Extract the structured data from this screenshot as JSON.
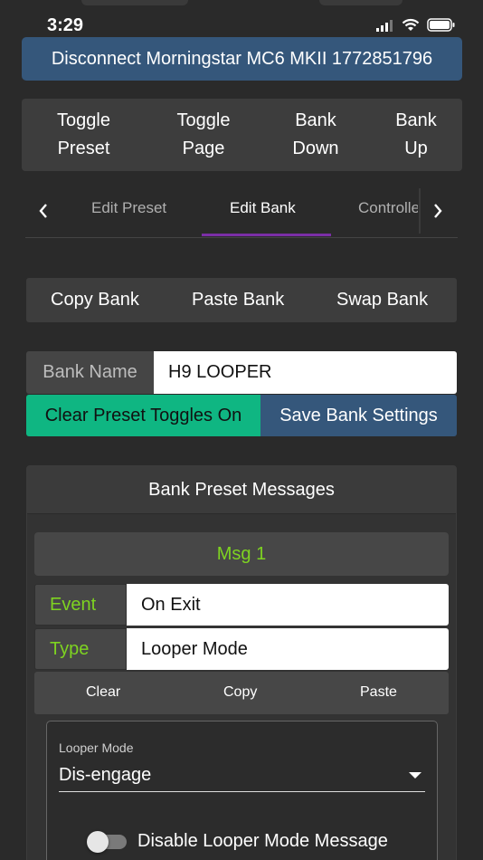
{
  "status_bar": {
    "time": "3:29",
    "icons": [
      "signal-icon",
      "wifi-icon",
      "battery-icon"
    ]
  },
  "header": {
    "disconnect_label": "Disconnect Morningstar MC6 MKII 1772851796"
  },
  "controls": {
    "toggle_preset": [
      "Toggle",
      "Preset"
    ],
    "toggle_page": [
      "Toggle",
      "Page"
    ],
    "bank_down": [
      "Bank",
      "Down"
    ],
    "bank_up": [
      "Bank",
      "Up"
    ]
  },
  "tabs": {
    "prev_icon": "chevron-left-icon",
    "next_icon": "chevron-right-icon",
    "items": [
      "Edit Preset",
      "Edit Bank",
      "Controlle"
    ],
    "active": "Edit Bank"
  },
  "bank_actions": {
    "copy": "Copy Bank",
    "paste": "Paste Bank",
    "swap": "Swap Bank"
  },
  "bank_name": {
    "label": "Bank Name",
    "value": "H9 LOOPER"
  },
  "buttons": {
    "clear_toggles": "Clear Preset Toggles On",
    "save_bank": "Save Bank Settings"
  },
  "messages": {
    "header": "Bank Preset Messages",
    "msg_title": "Msg 1",
    "event_label": "Event",
    "event_value": "On Exit",
    "type_label": "Type",
    "type_value": "Looper Mode",
    "actions": {
      "clear": "Clear",
      "copy": "Copy",
      "paste": "Paste"
    },
    "looper": {
      "label": "Looper Mode",
      "value": "Dis-engage",
      "disable_label": "Disable Looper Mode Message",
      "disable_on": false
    }
  },
  "colors": {
    "accent_blue": "#35577b",
    "accent_green": "#0fb682",
    "label_green": "#7ed321",
    "tab_underline": "#7b2fa6"
  }
}
